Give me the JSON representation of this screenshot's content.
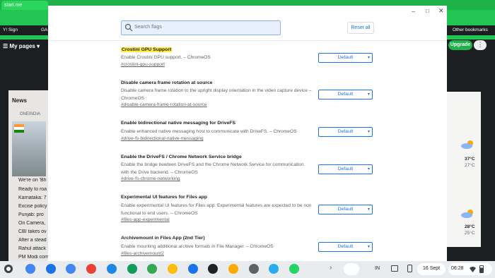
{
  "background": {
    "tab_title": "start.me",
    "bookmarks": [
      "Y! Sign",
      "GA",
      "Other bookmarks"
    ],
    "my_pages": "My pages",
    "upgrade": "Upgrade",
    "news_title": "News",
    "news_source": "ONEINDIA",
    "headlines": [
      "We're on 'Bh",
      "Ready to roa",
      "Karnataka: 7",
      "Excise policy",
      "Punjab: pro",
      "On Camera,",
      "CBI takes ov",
      "After a stead",
      "Rahul attack",
      "PM Modi com"
    ],
    "weather": [
      {
        "high": "37°C",
        "low": "27°C"
      },
      {
        "high": "28°C",
        "low": "25°C"
      }
    ]
  },
  "search": {
    "placeholder": "Search flags"
  },
  "reset_label": "Reset all",
  "flags": [
    {
      "title": "Crostini GPU Support",
      "desc": "Enable Crostini GPU support. – ChromeOS",
      "link": "#crostini-gpu-support",
      "value": "Default",
      "highlight": true
    },
    {
      "title": "Disable camera frame rotation at source",
      "desc": "Disable camera frame rotation to the upright display orientation in the video capture device – ChromeOS",
      "link": "#disable-camera-frame-rotation-at-source",
      "value": "Default"
    },
    {
      "title": "Enable bidirectional native messaging for DriveFS",
      "desc": "Enable enhanced native messaging host to communicate with DriveFS. – ChromeOS",
      "link": "#drive-fs-bidirectional-native-messaging",
      "value": "Default"
    },
    {
      "title": "Enable the DriveFS / Chrome Network Service bridge",
      "desc": "Enable the bridge bewteen DriveFS and the Chrome Network Service for communication with the Drive backend. – ChromeOS",
      "link": "#drive-fs-chrome-networking",
      "value": "Default"
    },
    {
      "title": "Experimental UI features for Files app",
      "desc": "Enable experimental UI features for Files app. Experimental features are expected to be non functional to end users. – ChromeOS",
      "link": "#files-app-experimental",
      "value": "Default"
    },
    {
      "title": "Archivemount in Files App (2nd Tier)",
      "desc": "Enable mounting additional archive formats in File Manager. – ChromeOS",
      "link": "#files-archivemount2",
      "value": "Default"
    }
  ],
  "shelf": {
    "apps": [
      "chrome-icon",
      "calendar-icon",
      "docs-icon",
      "gmail-icon",
      "files-icon",
      "sheets-icon",
      "drive-icon",
      "photos-icon",
      "chat-icon",
      "obsidian-icon",
      "notes-icon",
      "settings-icon",
      "telegram-icon",
      "whatsapp-icon"
    ],
    "lang": "IN",
    "date": "16 Sept",
    "time": "06:28",
    "colors": [
      "#4285f4",
      "#1a73e8",
      "#4285f4",
      "#ea4335",
      "#1e88e5",
      "#0f9d58",
      "#34a853",
      "#fbbc04",
      "#1a73e8",
      "#202124",
      "#f9ab00",
      "#5f6368",
      "#2aabee",
      "#25d366"
    ]
  }
}
